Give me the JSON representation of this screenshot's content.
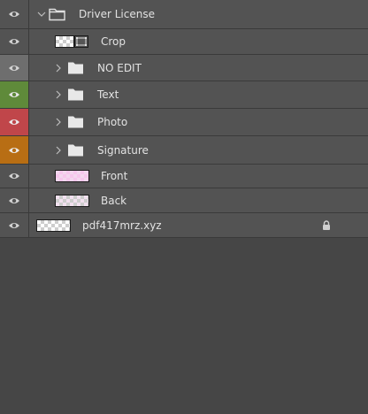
{
  "layers": {
    "driver_license": {
      "name": "Driver License",
      "eye_color": "#535353",
      "expanded": true
    },
    "crop": {
      "name": "Crop",
      "eye_color": "#535353"
    },
    "no_edit": {
      "name": "NO EDIT",
      "eye_color": "#6e6e6e"
    },
    "text": {
      "name": "Text",
      "eye_color": "#5f8a3a"
    },
    "photo": {
      "name": "Photo",
      "eye_color": "#c0464a"
    },
    "signature": {
      "name": "Signature",
      "eye_color": "#b86e14"
    },
    "front": {
      "name": "Front",
      "eye_color": "#535353"
    },
    "back": {
      "name": "Back",
      "eye_color": "#535353"
    },
    "pdf417": {
      "name": "pdf417mrz.xyz",
      "eye_color": "#535353",
      "locked": true
    }
  },
  "icons": {
    "visibility": "eye-icon",
    "group": "folder-icon",
    "collapsed": "chevron-right-icon",
    "expanded": "chevron-down-icon",
    "lock": "lock-icon",
    "mask": "vector-mask-icon"
  },
  "colors": {
    "panel_bg": "#464646",
    "row_bg": "#535353",
    "text": "#e2e2e2"
  }
}
